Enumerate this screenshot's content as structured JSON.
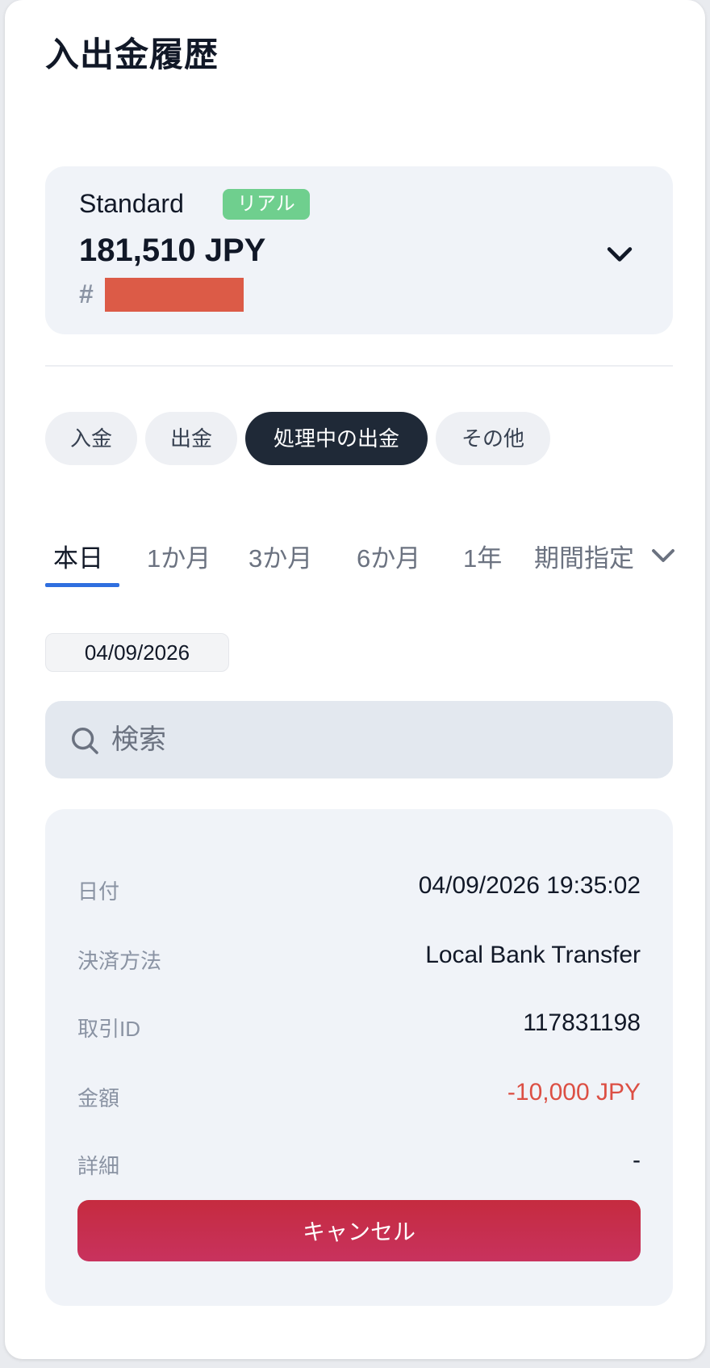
{
  "page": {
    "title": "入出金履歴"
  },
  "account": {
    "name": "Standard",
    "badge": "リアル",
    "balance": "181,510 JPY",
    "number_prefix": "#",
    "chevron_icon": "chevron-down-icon"
  },
  "type_tabs": [
    {
      "label": "入金",
      "active": false
    },
    {
      "label": "出金",
      "active": false
    },
    {
      "label": "処理中の出金",
      "active": true
    },
    {
      "label": "その他",
      "active": false
    }
  ],
  "period_tabs": [
    {
      "label": "本日",
      "active": true
    },
    {
      "label": "1か月",
      "active": false
    },
    {
      "label": "3か月",
      "active": false
    },
    {
      "label": "6か月",
      "active": false
    },
    {
      "label": "1年",
      "active": false
    }
  ],
  "period_custom": {
    "label": "期間指定",
    "icon": "chevron-down-icon"
  },
  "date_chip": "04/09/2026",
  "search": {
    "placeholder": "検索",
    "icon": "search-icon"
  },
  "transaction": {
    "rows": [
      {
        "label": "日付",
        "value": "04/09/2026 19:35:02"
      },
      {
        "label": "決済方法",
        "value": "Local Bank Transfer"
      },
      {
        "label": "取引ID",
        "value": "117831198"
      },
      {
        "label": "金額",
        "value": "-10,000 JPY"
      },
      {
        "label": "詳細",
        "value": "-"
      }
    ],
    "cancel_label": "キャンセル"
  },
  "colors": {
    "accent_tab_underline": "#2f6fdf",
    "active_tab_bg": "#1f2937",
    "badge_bg": "#6fcf8e",
    "negative_amount": "#dc4f44",
    "cancel_button": "#c52b3f",
    "redaction": "#dc5b47"
  }
}
